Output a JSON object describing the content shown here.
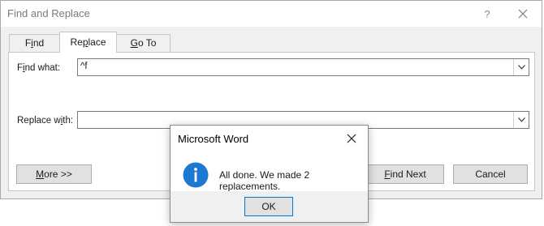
{
  "dialog": {
    "title": "Find and Replace",
    "help_glyph": "?",
    "tabs": [
      {
        "label_mn": "F",
        "label_a": "i",
        "label_b": "nd",
        "label_underline_index": 2
      },
      {
        "label_a": "Re",
        "label_mn": "p",
        "label_b": "lace",
        "active": true
      },
      {
        "label_mn": "G",
        "label_a": "",
        "label_b": "o To"
      }
    ],
    "find_label_a": "F",
    "find_label_mn": "i",
    "find_label_b": "nd what:",
    "find_value": "^f",
    "replace_label_a": "Replace w",
    "replace_label_mn": "i",
    "replace_label_b": "th:",
    "replace_value": "",
    "more_mn": "M",
    "more_rest": "ore >>",
    "find_next_mn": "F",
    "find_next_rest": "ind Next",
    "cancel_label": "Cancel"
  },
  "message_box": {
    "title": "Microsoft Word",
    "text": "All done. We made 2 replacements.",
    "ok_label": "OK",
    "icon": "info-icon"
  },
  "colors": {
    "info_blue": "#1e78d0",
    "focus_border": "#0078d7"
  }
}
